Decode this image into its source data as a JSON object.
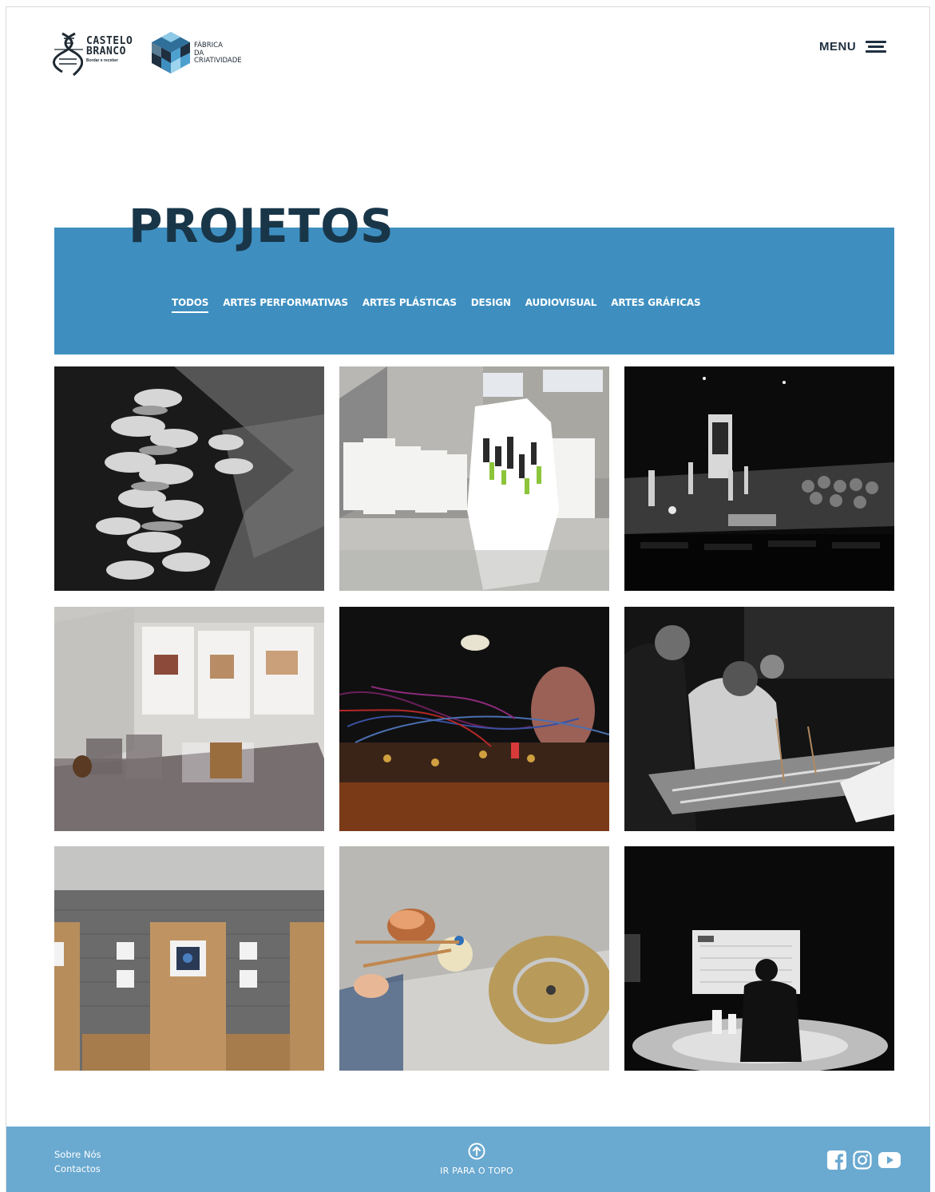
{
  "header": {
    "logo_cb": {
      "line1": "CASTELO",
      "line2": "BRANCO",
      "tagline": "Bordar e receber"
    },
    "logo_fc": {
      "line1": "FÁBRICA",
      "line2": "DA",
      "line3": "CRIATIVIDADE"
    },
    "menu_label": "MENU"
  },
  "page": {
    "title": "PROJETOS",
    "filters": [
      {
        "label": "TODOS",
        "active": true
      },
      {
        "label": "ARTES PERFORMATIVAS"
      },
      {
        "label": "ARTES PLÁSTICAS"
      },
      {
        "label": "DESIGN"
      },
      {
        "label": "AUDIOVISUAL"
      },
      {
        "label": "ARTES GRÁFICAS"
      }
    ]
  },
  "projects": [
    {
      "image": "banana-sculpture-bw"
    },
    {
      "image": "white-shirts-exhibition"
    },
    {
      "image": "stage-performance-dark"
    },
    {
      "image": "design-objects-display"
    },
    {
      "image": "modular-synth-cables"
    },
    {
      "image": "percussion-players"
    },
    {
      "image": "wood-panel-art-exhibition"
    },
    {
      "image": "percussion-instruments-table"
    },
    {
      "image": "projection-presenter-silhouette"
    }
  ],
  "footer": {
    "links": [
      "Sobre Nós",
      "Contactos"
    ],
    "to_top_label": "IR PARA O TOPO",
    "socials": [
      "facebook-icon",
      "instagram-icon",
      "youtube-icon"
    ]
  },
  "colors": {
    "banner": "#3e8fc0",
    "footer": "#6aa9d0",
    "title": "#193649"
  }
}
